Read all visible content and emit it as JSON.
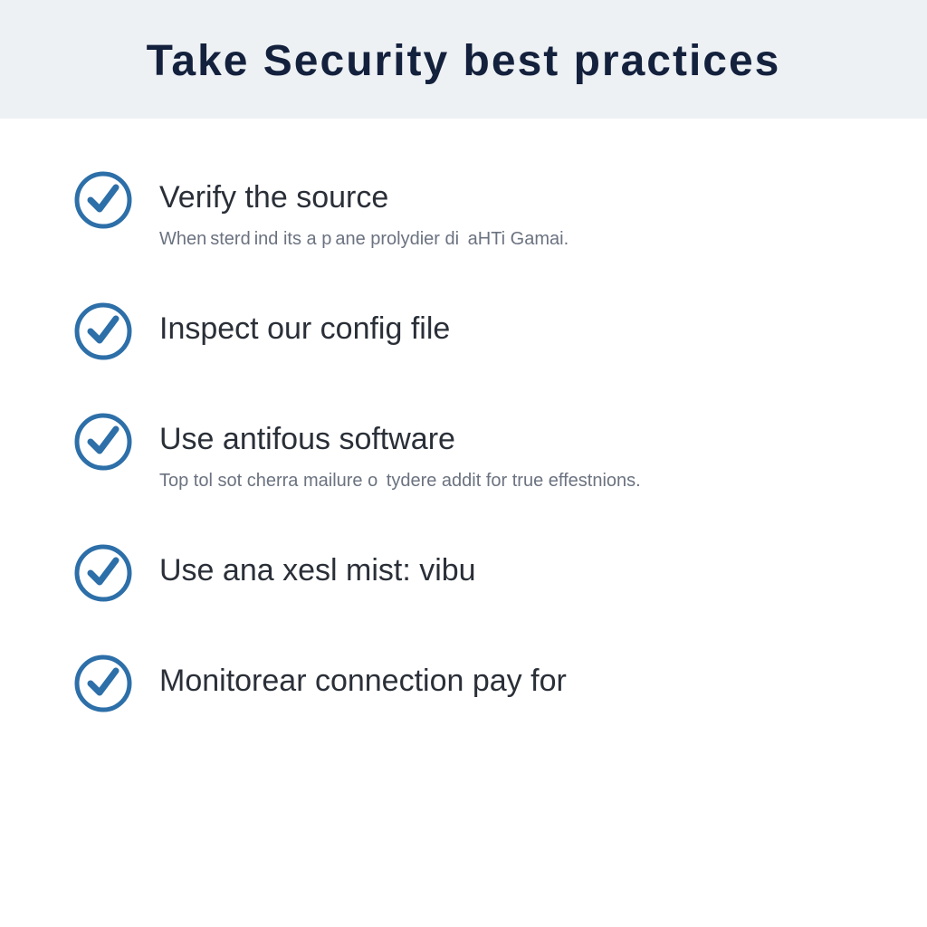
{
  "header": {
    "title": "Take  Security  best  practices"
  },
  "items": [
    {
      "title": "Verify the source",
      "desc": "When sterd ind its a p ane prolydier di  aHTi Gamai."
    },
    {
      "title": "Inspect our config file",
      "desc": ""
    },
    {
      "title": "Use antifous software",
      "desc": "Top tol sot cherra mailure o  tydere addit for true effestnions."
    },
    {
      "title": "Use ana xesl mist: vibu",
      "desc": ""
    },
    {
      "title": "Monitorear connection pay for",
      "desc": ""
    }
  ]
}
